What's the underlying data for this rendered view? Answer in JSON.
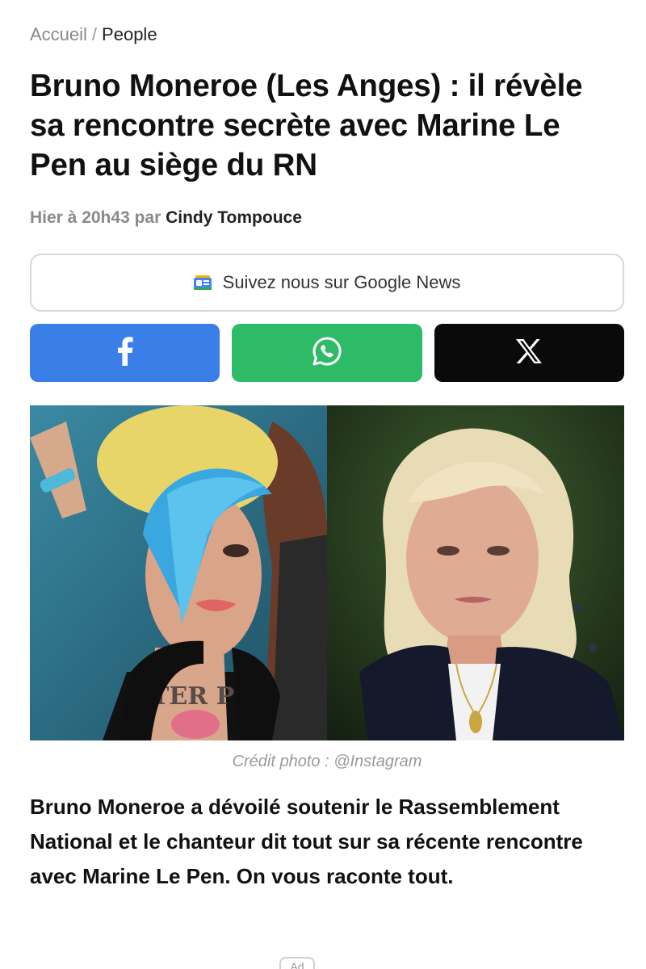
{
  "breadcrumb": {
    "home": "Accueil",
    "separator": "/",
    "current": "People"
  },
  "article": {
    "title": "Bruno Moneroe (Les Anges) : il révèle sa rencontre secrète avec Marine Le Pen au siège du RN",
    "date_prefix": "Hier à 20h43 par",
    "author": "Cindy Tompouce",
    "photo_credit": "Crédit photo : @Instagram",
    "lead": "Bruno Moneroe a dévoilé soutenir le Rassemblement National et le chanteur dit tout sur sa récente rencontre avec Marine Le Pen. On vous raconte tout."
  },
  "google_news": {
    "label": "Suivez nous sur Google News",
    "icon": "google-news-icon"
  },
  "share": {
    "facebook_icon": "facebook-icon",
    "whatsapp_icon": "whatsapp-icon",
    "x_icon": "x-icon",
    "colors": {
      "facebook": "#3a7ee8",
      "whatsapp": "#2dbb68",
      "x": "#0a0a0a"
    }
  },
  "ad": {
    "label": "Ad"
  }
}
